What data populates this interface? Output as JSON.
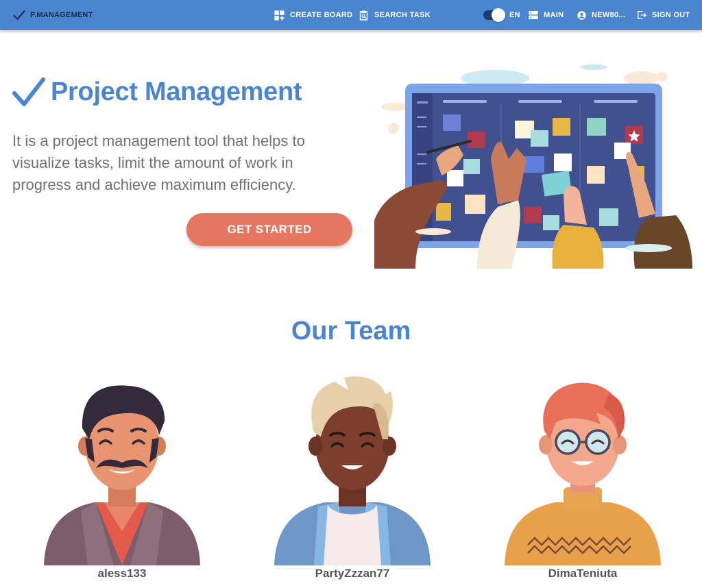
{
  "header": {
    "brand": "P.MANAGEMENT",
    "create_board": "CREATE BOARD",
    "search_task": "SEARCH TASK",
    "language": "EN",
    "main": "MAIN",
    "user": "NEW80...",
    "sign_out": "SIGN OUT"
  },
  "hero": {
    "title": "Project Management",
    "description": "It is a project management tool that helps to visualize tasks, limit the amount of work in progress and achieve maximum efficiency.",
    "cta_label": "GET STARTED"
  },
  "team": {
    "title": "Our Team",
    "members": [
      {
        "name": "aless133"
      },
      {
        "name": "PartyZzzan77"
      },
      {
        "name": "DimaTeniuta"
      }
    ]
  },
  "colors": {
    "primary": "#4a86d0",
    "accent": "#e5765f"
  }
}
